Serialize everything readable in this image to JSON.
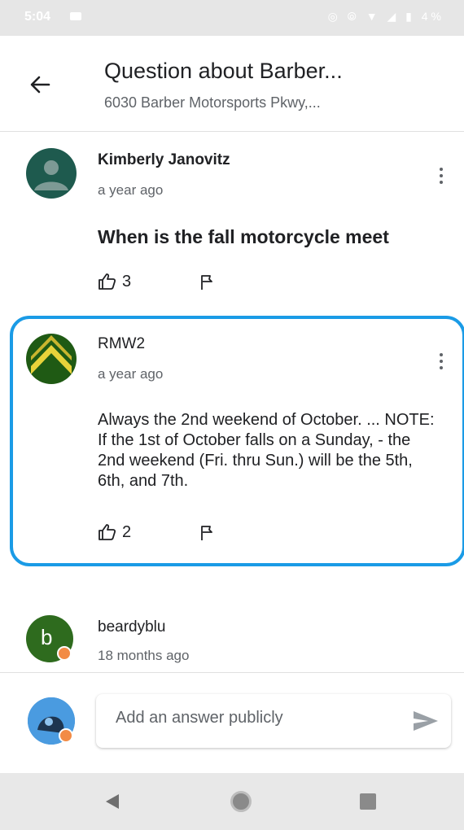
{
  "status_bar": {
    "time": "5:04",
    "icons": "◎ ⦾ ▼ ◢ ▮ 4%"
  },
  "header": {
    "title": "Question about Barber...",
    "subtitle": "6030 Barber Motorsports Pkwy,..."
  },
  "answers": [
    {
      "author": "Kimberly Janovitz",
      "time": "a year ago",
      "text": "When is the fall motorcycle meet",
      "likes": "3",
      "avatar_color": "#1e5a4e"
    },
    {
      "author": "RMW2",
      "time": "a year ago",
      "text": "Always the 2nd weekend of October. ... NOTE: If the 1st of October falls on a Sunday, - the 2nd weekend (Fri. thru Sun.) will be the 5th, 6th, and 7th.",
      "likes": "2",
      "avatar_color": "#1f5a14"
    },
    {
      "author": "beardyblu",
      "time": "18 months ago",
      "avatar_letter": "b",
      "avatar_color": "#2e6b1e"
    }
  ],
  "composer": {
    "placeholder": "Add an answer publicly"
  },
  "colors": {
    "highlight": "#1a9be6",
    "badge": "#f28b45"
  },
  "icons": {
    "back": "arrow-left-icon",
    "more": "more-vertical-icon",
    "like": "thumb-up-icon",
    "flag": "flag-icon",
    "send": "send-icon"
  }
}
